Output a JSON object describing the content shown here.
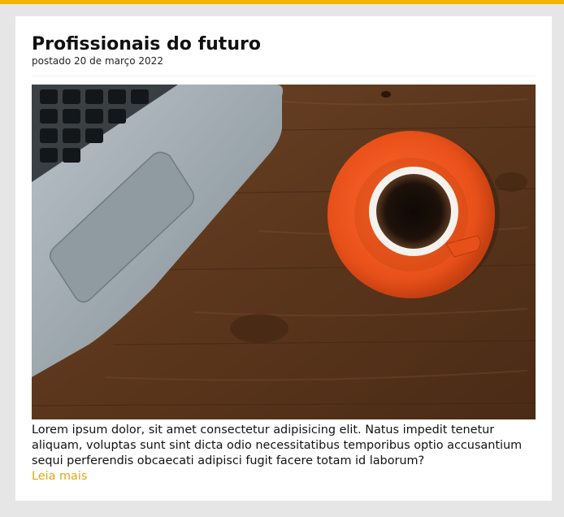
{
  "colors": {
    "accent": "#f4b400",
    "link": "#e0a80e",
    "background": "#e6e6e6"
  },
  "post": {
    "title": "Profissionais do futuro",
    "meta": "postado 20 de março 2022",
    "image_icon": "laptop-coffee-photo",
    "excerpt": "Lorem ipsum dolor, sit amet consectetur adipisicing elit. Natus impedit tenetur aliquam, voluptas sunt sint dicta odio necessitatibus temporibus optio accusantium sequi perferendis obcaecati adipisci fugit facere totam id laborum?",
    "read_more": "Leia mais"
  }
}
